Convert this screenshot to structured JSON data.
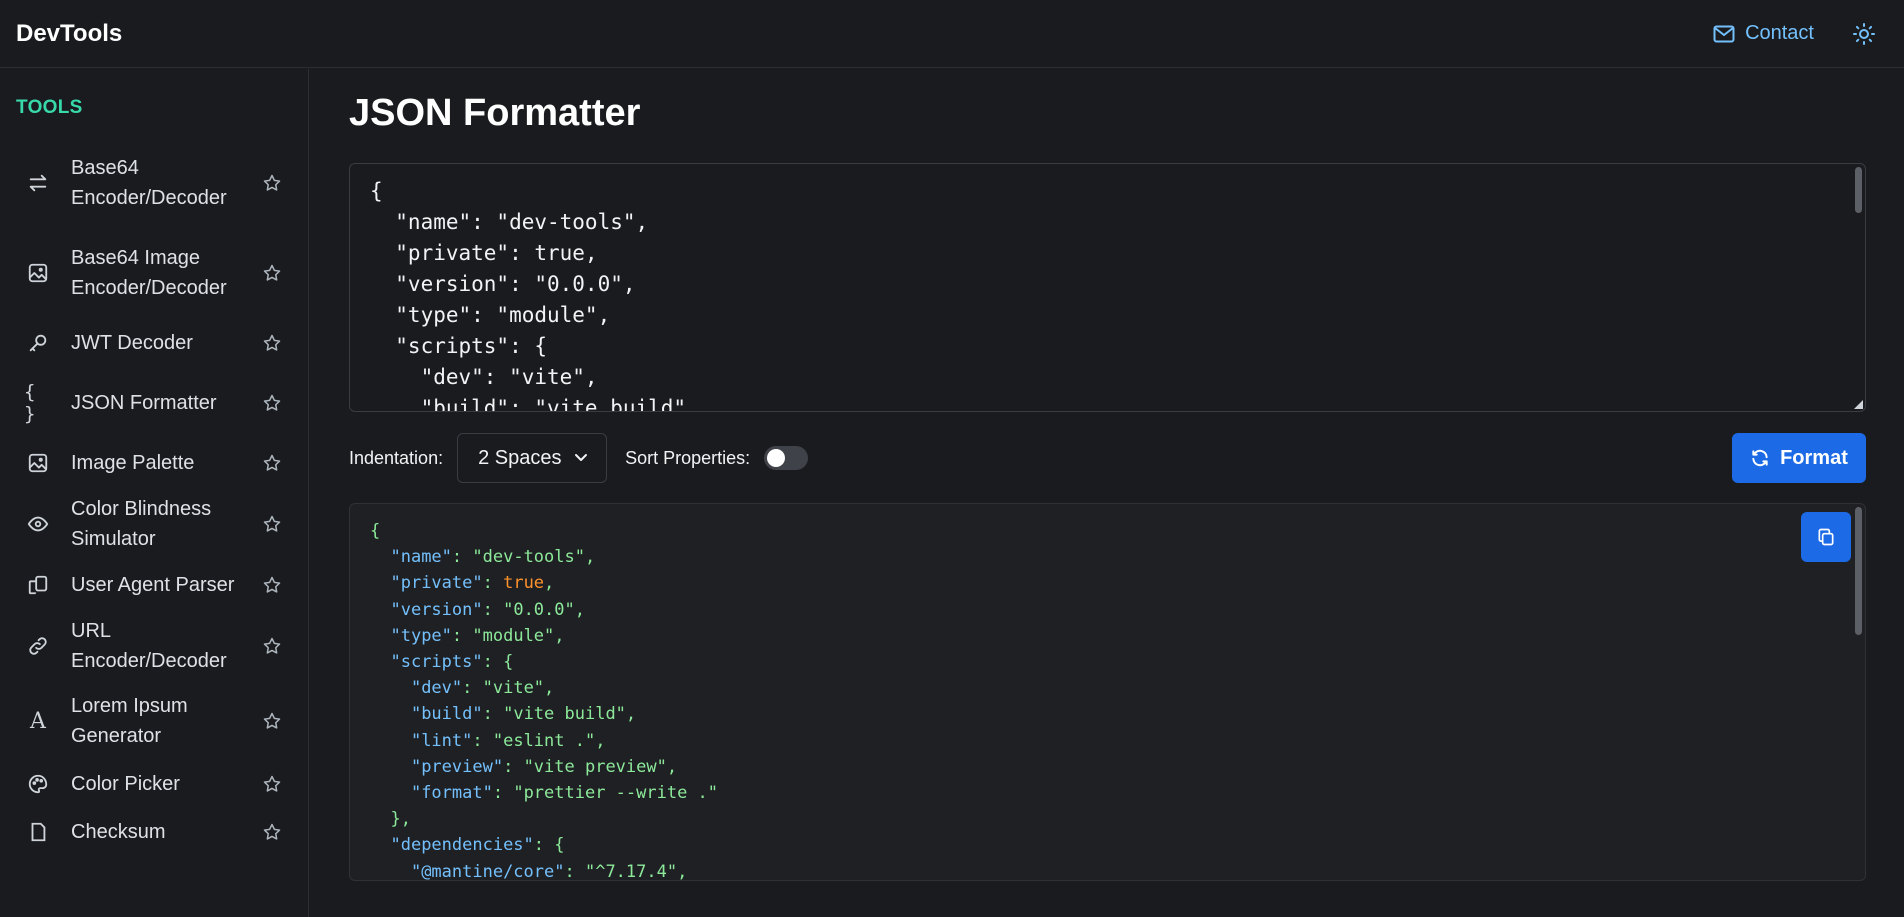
{
  "header": {
    "brand": "DevTools",
    "contact_label": "Contact",
    "contact_icon": "mail-icon",
    "theme_icon": "sun-icon"
  },
  "sidebar": {
    "title": "TOOLS",
    "items": [
      {
        "label": "Base64 Encoder/Decoder",
        "icon": "arrows-exchange-icon"
      },
      {
        "label": "Base64 Image Encoder/Decoder",
        "icon": "photo-icon"
      },
      {
        "label": "JWT Decoder",
        "icon": "key-icon"
      },
      {
        "label": "JSON Formatter",
        "icon": "braces-icon"
      },
      {
        "label": "Image Palette",
        "icon": "photo-icon"
      },
      {
        "label": "Color Blindness Simulator",
        "icon": "eye-icon"
      },
      {
        "label": "User Agent Parser",
        "icon": "devices-icon"
      },
      {
        "label": "URL Encoder/Decoder",
        "icon": "link-icon"
      },
      {
        "label": "Lorem Ipsum Generator",
        "icon": "typography-icon"
      },
      {
        "label": "Color Picker",
        "icon": "palette-icon"
      },
      {
        "label": "Checksum",
        "icon": "file-icon"
      }
    ]
  },
  "main": {
    "title": "JSON Formatter",
    "input_value": "{\n  \"name\": \"dev-tools\",\n  \"private\": true,\n  \"version\": \"0.0.0\",\n  \"type\": \"module\",\n  \"scripts\": {\n    \"dev\": \"vite\",\n    \"build\": \"vite build\",",
    "indentation_label": "Indentation:",
    "indentation_value": "2 Spaces",
    "sort_label": "Sort Properties:",
    "sort_enabled": false,
    "format_label": "Format",
    "output_lines": [
      {
        "indent": 0,
        "key": null,
        "value": "{",
        "type": "punct"
      },
      {
        "indent": 1,
        "key": "name",
        "value": "\"dev-tools\"",
        "type": "string",
        "comma": true
      },
      {
        "indent": 1,
        "key": "private",
        "value": "true",
        "type": "bool",
        "comma": true
      },
      {
        "indent": 1,
        "key": "version",
        "value": "\"0.0.0\"",
        "type": "string",
        "comma": true
      },
      {
        "indent": 1,
        "key": "type",
        "value": "\"module\"",
        "type": "string",
        "comma": true
      },
      {
        "indent": 1,
        "key": "scripts",
        "value": "{",
        "type": "punct"
      },
      {
        "indent": 2,
        "key": "dev",
        "value": "\"vite\"",
        "type": "string",
        "comma": true
      },
      {
        "indent": 2,
        "key": "build",
        "value": "\"vite build\"",
        "type": "string",
        "comma": true
      },
      {
        "indent": 2,
        "key": "lint",
        "value": "\"eslint .\"",
        "type": "string",
        "comma": true
      },
      {
        "indent": 2,
        "key": "preview",
        "value": "\"vite preview\"",
        "type": "string",
        "comma": true
      },
      {
        "indent": 2,
        "key": "format",
        "value": "\"prettier --write .\"",
        "type": "string"
      },
      {
        "indent": 1,
        "key": null,
        "value": "},",
        "type": "punct"
      },
      {
        "indent": 1,
        "key": "dependencies",
        "value": "{",
        "type": "punct"
      },
      {
        "indent": 2,
        "key": "@mantine/core",
        "value": "\"^7.17.4\"",
        "type": "string",
        "comma": true
      }
    ]
  },
  "colors": {
    "accent": "#1c6ae5",
    "tools_heading": "#38d9a9",
    "contact": "#74c0fc",
    "json_key": "#74c0fc",
    "json_string": "#8ce99a",
    "json_bool": "#ff922b"
  }
}
